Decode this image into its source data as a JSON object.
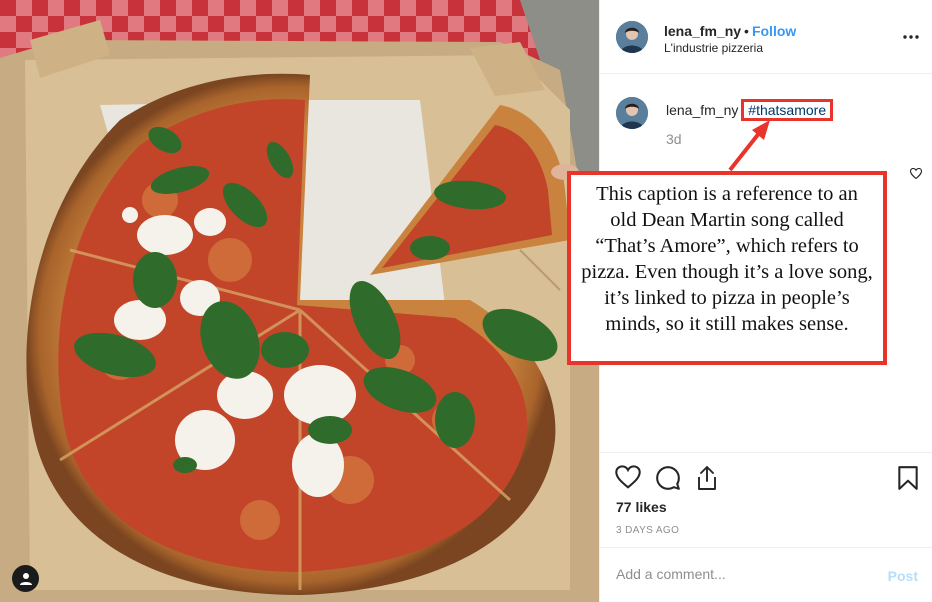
{
  "post": {
    "username": "lena_fm_ny",
    "separator": "•",
    "follow_label": "Follow",
    "location": "L'industrie pizzeria",
    "more_icon": "more-horizontal-icon"
  },
  "caption": {
    "username": "lena_fm_ny",
    "hashtag": "#thatsamore",
    "time": "3d"
  },
  "stats": {
    "likes": "77 likes",
    "date": "3 DAYS AGO"
  },
  "comment": {
    "placeholder": "Add a comment...",
    "post_label": "Post"
  },
  "annotation": {
    "text": "This caption is a reference to an old Dean Martin song called “That’s Amore”, which refers to pizza. Even though it’s a love song, it’s linked to pizza in people’s minds, so it still makes sense.",
    "highlight_color": "#e8342a"
  },
  "colors": {
    "link": "#3897f0",
    "hashtag": "#00376b",
    "muted": "#8e8e8e",
    "post_disabled": "#b2dffc"
  }
}
